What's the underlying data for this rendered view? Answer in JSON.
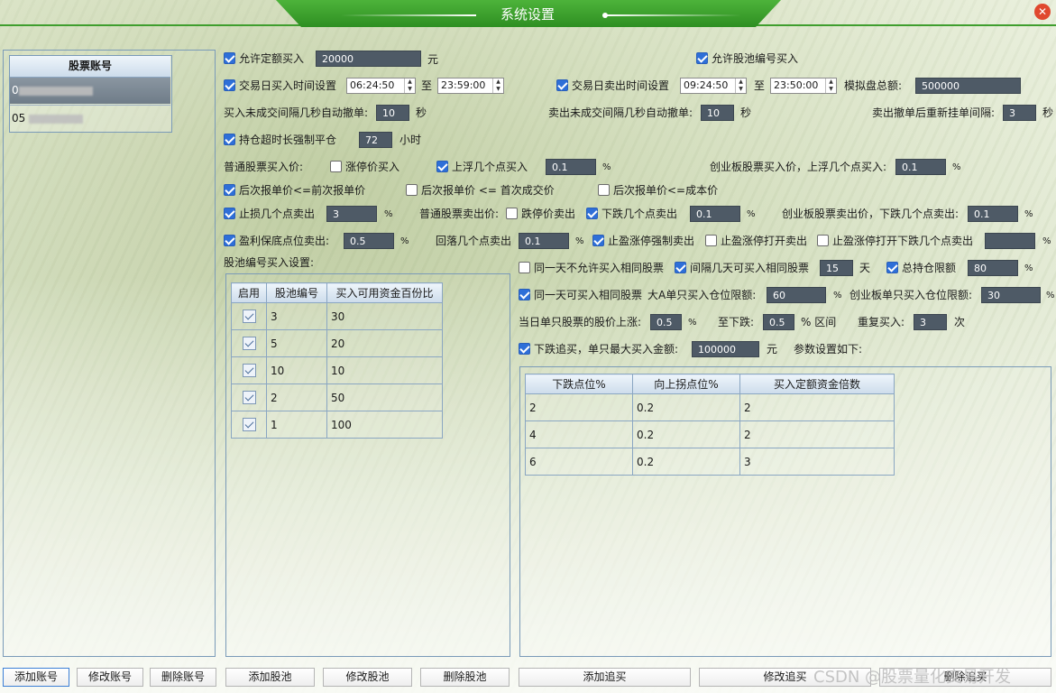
{
  "window": {
    "title": "系统设置",
    "close_glyph": "✕"
  },
  "accounts": {
    "header": "股票账号",
    "rows": [
      {
        "prefix": "0"
      },
      {
        "prefix": "05"
      }
    ]
  },
  "settings": {
    "allow_fixed_amount_buy": {
      "label": "允许定额买入",
      "value": "20000",
      "unit": "元",
      "checked": true
    },
    "allow_pool_buy": {
      "label": "允许股池编号买入",
      "checked": true
    },
    "buy_time": {
      "label": "交易日买入时间设置",
      "start": "06:24:50",
      "to": "至",
      "end": "23:59:00",
      "checked": true
    },
    "sell_time": {
      "label": "交易日卖出时间设置",
      "start": "09:24:50",
      "to": "至",
      "end": "23:50:00",
      "checked": true
    },
    "sim_total": {
      "label": "模拟盘总额:",
      "value": "500000"
    },
    "buy_cancel": {
      "label": "买入未成交间隔几秒自动撤单:",
      "value": "10",
      "unit": "秒"
    },
    "sell_cancel": {
      "label": "卖出未成交间隔几秒自动撤单:",
      "value": "10",
      "unit": "秒"
    },
    "resubmit": {
      "label": "卖出撤单后重新挂单间隔:",
      "value": "3",
      "unit": "秒"
    },
    "hold_timeout": {
      "label": "持仓超时长强制平仓",
      "value": "72",
      "unit": "小时",
      "checked": true
    },
    "normal_buy_price": {
      "label": "普通股票买入价:",
      "limit_up_buy": "涨停价买入",
      "float_up_buy": "上浮几个点买入",
      "value": "0.1",
      "unit": "%",
      "limit_up_checked": false,
      "float_checked": true
    },
    "gem_buy": {
      "label": "创业板股票买入价，上浮几个点买入:",
      "value": "0.1",
      "unit": "%"
    },
    "next_le_prev": {
      "label": "后次报单价<=前次报单价",
      "checked": true
    },
    "next_le_first": {
      "label": "后次报单价  <=  首次成交价",
      "checked": false
    },
    "next_le_cost": {
      "label": "后次报单价<=成本价",
      "checked": false
    },
    "stop_loss": {
      "label": "止损几个点卖出",
      "value": "3",
      "unit": "%",
      "checked": true
    },
    "normal_sell_price": {
      "label": "普通股票卖出价:",
      "limit_down_sell": "跌停价卖出",
      "drop_sell": "下跌几个点卖出",
      "value": "0.1",
      "unit": "%",
      "limit_down_checked": false,
      "drop_checked": true
    },
    "gem_sell": {
      "label": "创业板股票卖出价，下跌几个点卖出:",
      "value": "0.1",
      "unit": "%"
    },
    "profit_floor": {
      "label": "盈利保底点位卖出:",
      "value": "0.5",
      "unit": "%",
      "checked": true
    },
    "pullback": {
      "label": "回落几个点卖出",
      "value": "0.1",
      "unit": "%"
    },
    "limit_up_force": {
      "label": "止盈涨停强制卖出",
      "checked": true
    },
    "limit_up_open": {
      "label": "止盈涨停打开卖出",
      "checked": false
    },
    "limit_up_open_drop": {
      "label": "止盈涨停打开下跌几个点卖出",
      "value": "",
      "unit": "%",
      "checked": false
    },
    "pool_buy_settings": {
      "label": "股池编号买入设置:"
    },
    "same_day_no_repeat": {
      "label": "同一天不允许买入相同股票",
      "checked": false
    },
    "interval_days": {
      "label": "间隔几天可买入相同股票",
      "value": "15",
      "unit": "天",
      "checked": true
    },
    "total_limit": {
      "label": "总持仓限额",
      "value": "80",
      "unit": "%",
      "checked": true
    },
    "same_day_repeat": {
      "label": "同一天可买入相同股票",
      "checked": true
    },
    "a_single_limit": {
      "label": "大A单只买入仓位限额:",
      "value": "60",
      "unit": "%"
    },
    "gem_single_limit": {
      "label": "创业板单只买入仓位限额:",
      "value": "30",
      "unit": "%"
    },
    "price_range": {
      "label_up": "当日单只股票的股价上涨:",
      "up": "0.5",
      "unit_up": "%",
      "label_down": "至下跌:",
      "down": "0.5",
      "unit_down": "% 区间",
      "label_repeat": "重复买入:",
      "repeat": "3",
      "unit_repeat": "次"
    },
    "chase": {
      "label": "下跌追买，单只最大买入金额:",
      "value": "100000",
      "unit": "元",
      "params_label": "参数设置如下:",
      "checked": true
    }
  },
  "pool_table": {
    "headers": [
      "启用",
      "股池编号",
      "买入可用资金百份比"
    ],
    "rows": [
      {
        "enabled": true,
        "id": "3",
        "percent": "30"
      },
      {
        "enabled": true,
        "id": "5",
        "percent": "20"
      },
      {
        "enabled": true,
        "id": "10",
        "percent": "10"
      },
      {
        "enabled": true,
        "id": "2",
        "percent": "50"
      },
      {
        "enabled": true,
        "id": "1",
        "percent": "100"
      }
    ]
  },
  "chase_table": {
    "headers": [
      "下跌点位%",
      "向上拐点位%",
      "买入定额资金倍数"
    ],
    "rows": [
      {
        "drop": "2",
        "turn": "0.2",
        "mult": "2"
      },
      {
        "drop": "4",
        "turn": "0.2",
        "mult": "2"
      },
      {
        "drop": "6",
        "turn": "0.2",
        "mult": "3"
      }
    ]
  },
  "buttons": {
    "add_account": "添加账号",
    "edit_account": "修改账号",
    "delete_account": "删除账号",
    "add_pool": "添加股池",
    "edit_pool": "修改股池",
    "delete_pool": "删除股池",
    "add_chase": "添加追买",
    "edit_chase": "修改追买",
    "delete_chase": "删除追买"
  },
  "watermark": "CSDN @股票量化交易开发"
}
